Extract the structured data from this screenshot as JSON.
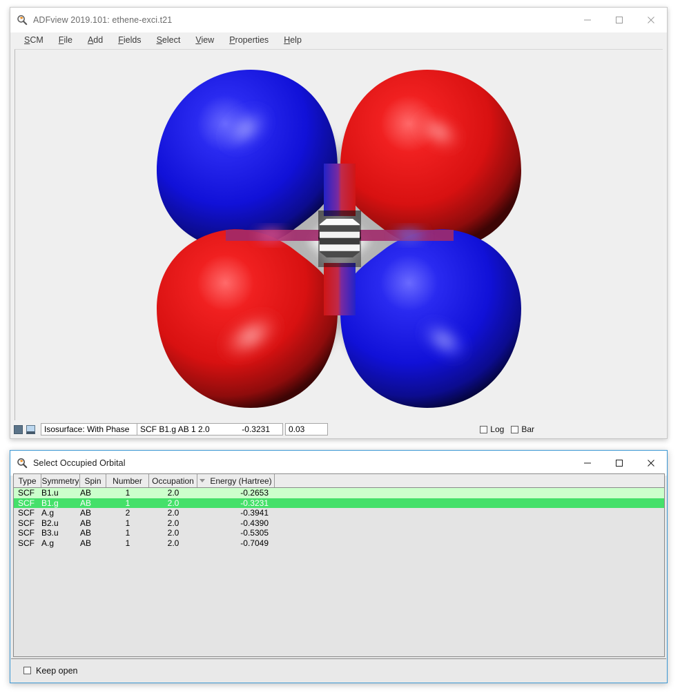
{
  "viewer_window": {
    "title": "ADFview 2019.101: ethene-exci.t21",
    "icon": "magnifier-icon",
    "controls": {
      "minimize": "minimize-icon",
      "maximize": "maximize-icon",
      "close": "close-icon"
    },
    "menus": [
      {
        "label": "SCM",
        "mnemonic": "S",
        "rest": "CM"
      },
      {
        "label": "File",
        "mnemonic": "F",
        "rest": "ile"
      },
      {
        "label": "Add",
        "mnemonic": "A",
        "rest": "dd"
      },
      {
        "label": "Fields",
        "mnemonic": "F",
        "rest": "ields"
      },
      {
        "label": "Select",
        "mnemonic": "S",
        "rest": "elect"
      },
      {
        "label": "View",
        "mnemonic": "V",
        "rest": "iew"
      },
      {
        "label": "Properties",
        "mnemonic": "P",
        "rest": "roperties"
      },
      {
        "label": "Help",
        "mnemonic": "H",
        "rest": "elp"
      }
    ],
    "statusbar": {
      "isosurface_field": "Isosurface: With Phase",
      "orbital_label": "SCF B1.g AB 1 2.0",
      "orbital_energy": "-0.3231",
      "iso_value": "0.03",
      "log_label": "Log",
      "log_checked": false,
      "bar_label": "Bar",
      "bar_checked": false
    },
    "scene": {
      "description": "molecular-orbital-isosurface",
      "molecule": "ethene",
      "lobes": [
        {
          "position": "upper-left",
          "phase": "negative",
          "color": "#1515e8"
        },
        {
          "position": "upper-right",
          "phase": "positive",
          "color": "#e81212"
        },
        {
          "position": "lower-left",
          "phase": "positive",
          "color": "#e81212"
        },
        {
          "position": "lower-right",
          "phase": "negative",
          "color": "#1515e8"
        }
      ],
      "positive_color": "#e81212",
      "negative_color": "#1515e8",
      "background_color": "#efefef"
    }
  },
  "select_window": {
    "title": "Select Occupied Orbital",
    "icon": "magnifier-icon",
    "controls": {
      "minimize": "minimize-icon",
      "maximize": "maximize-icon",
      "close": "close-icon"
    },
    "table": {
      "columns": [
        "Type",
        "Symmetry",
        "Spin",
        "Number",
        "Occupation",
        "Energy (Hartree)"
      ],
      "sorted_column": "Energy (Hartree)",
      "sort_direction": "descending",
      "rows": [
        {
          "type": "SCF",
          "symmetry": "B1.u",
          "spin": "AB",
          "number": "1",
          "occupation": "2.0",
          "energy": "-0.2653",
          "state": "hover"
        },
        {
          "type": "SCF",
          "symmetry": "B1.g",
          "spin": "AB",
          "number": "1",
          "occupation": "2.0",
          "energy": "-0.3231",
          "state": "selected"
        },
        {
          "type": "SCF",
          "symmetry": "A.g",
          "spin": "AB",
          "number": "2",
          "occupation": "2.0",
          "energy": "-0.3941",
          "state": "normal"
        },
        {
          "type": "SCF",
          "symmetry": "B2.u",
          "spin": "AB",
          "number": "1",
          "occupation": "2.0",
          "energy": "-0.4390",
          "state": "normal"
        },
        {
          "type": "SCF",
          "symmetry": "B3.u",
          "spin": "AB",
          "number": "1",
          "occupation": "2.0",
          "energy": "-0.5305",
          "state": "normal"
        },
        {
          "type": "SCF",
          "symmetry": "A.g",
          "spin": "AB",
          "number": "1",
          "occupation": "2.0",
          "energy": "-0.7049",
          "state": "normal"
        }
      ]
    },
    "footer": {
      "keep_open_label": "Keep open",
      "keep_open_checked": false
    }
  },
  "colors": {
    "selection_strong": "#45e06a",
    "selection_light": "#ccffcc",
    "active_window_border": "#3b97d3",
    "window_chrome": "#f0f0f0",
    "accent_orange": "#f08000"
  }
}
